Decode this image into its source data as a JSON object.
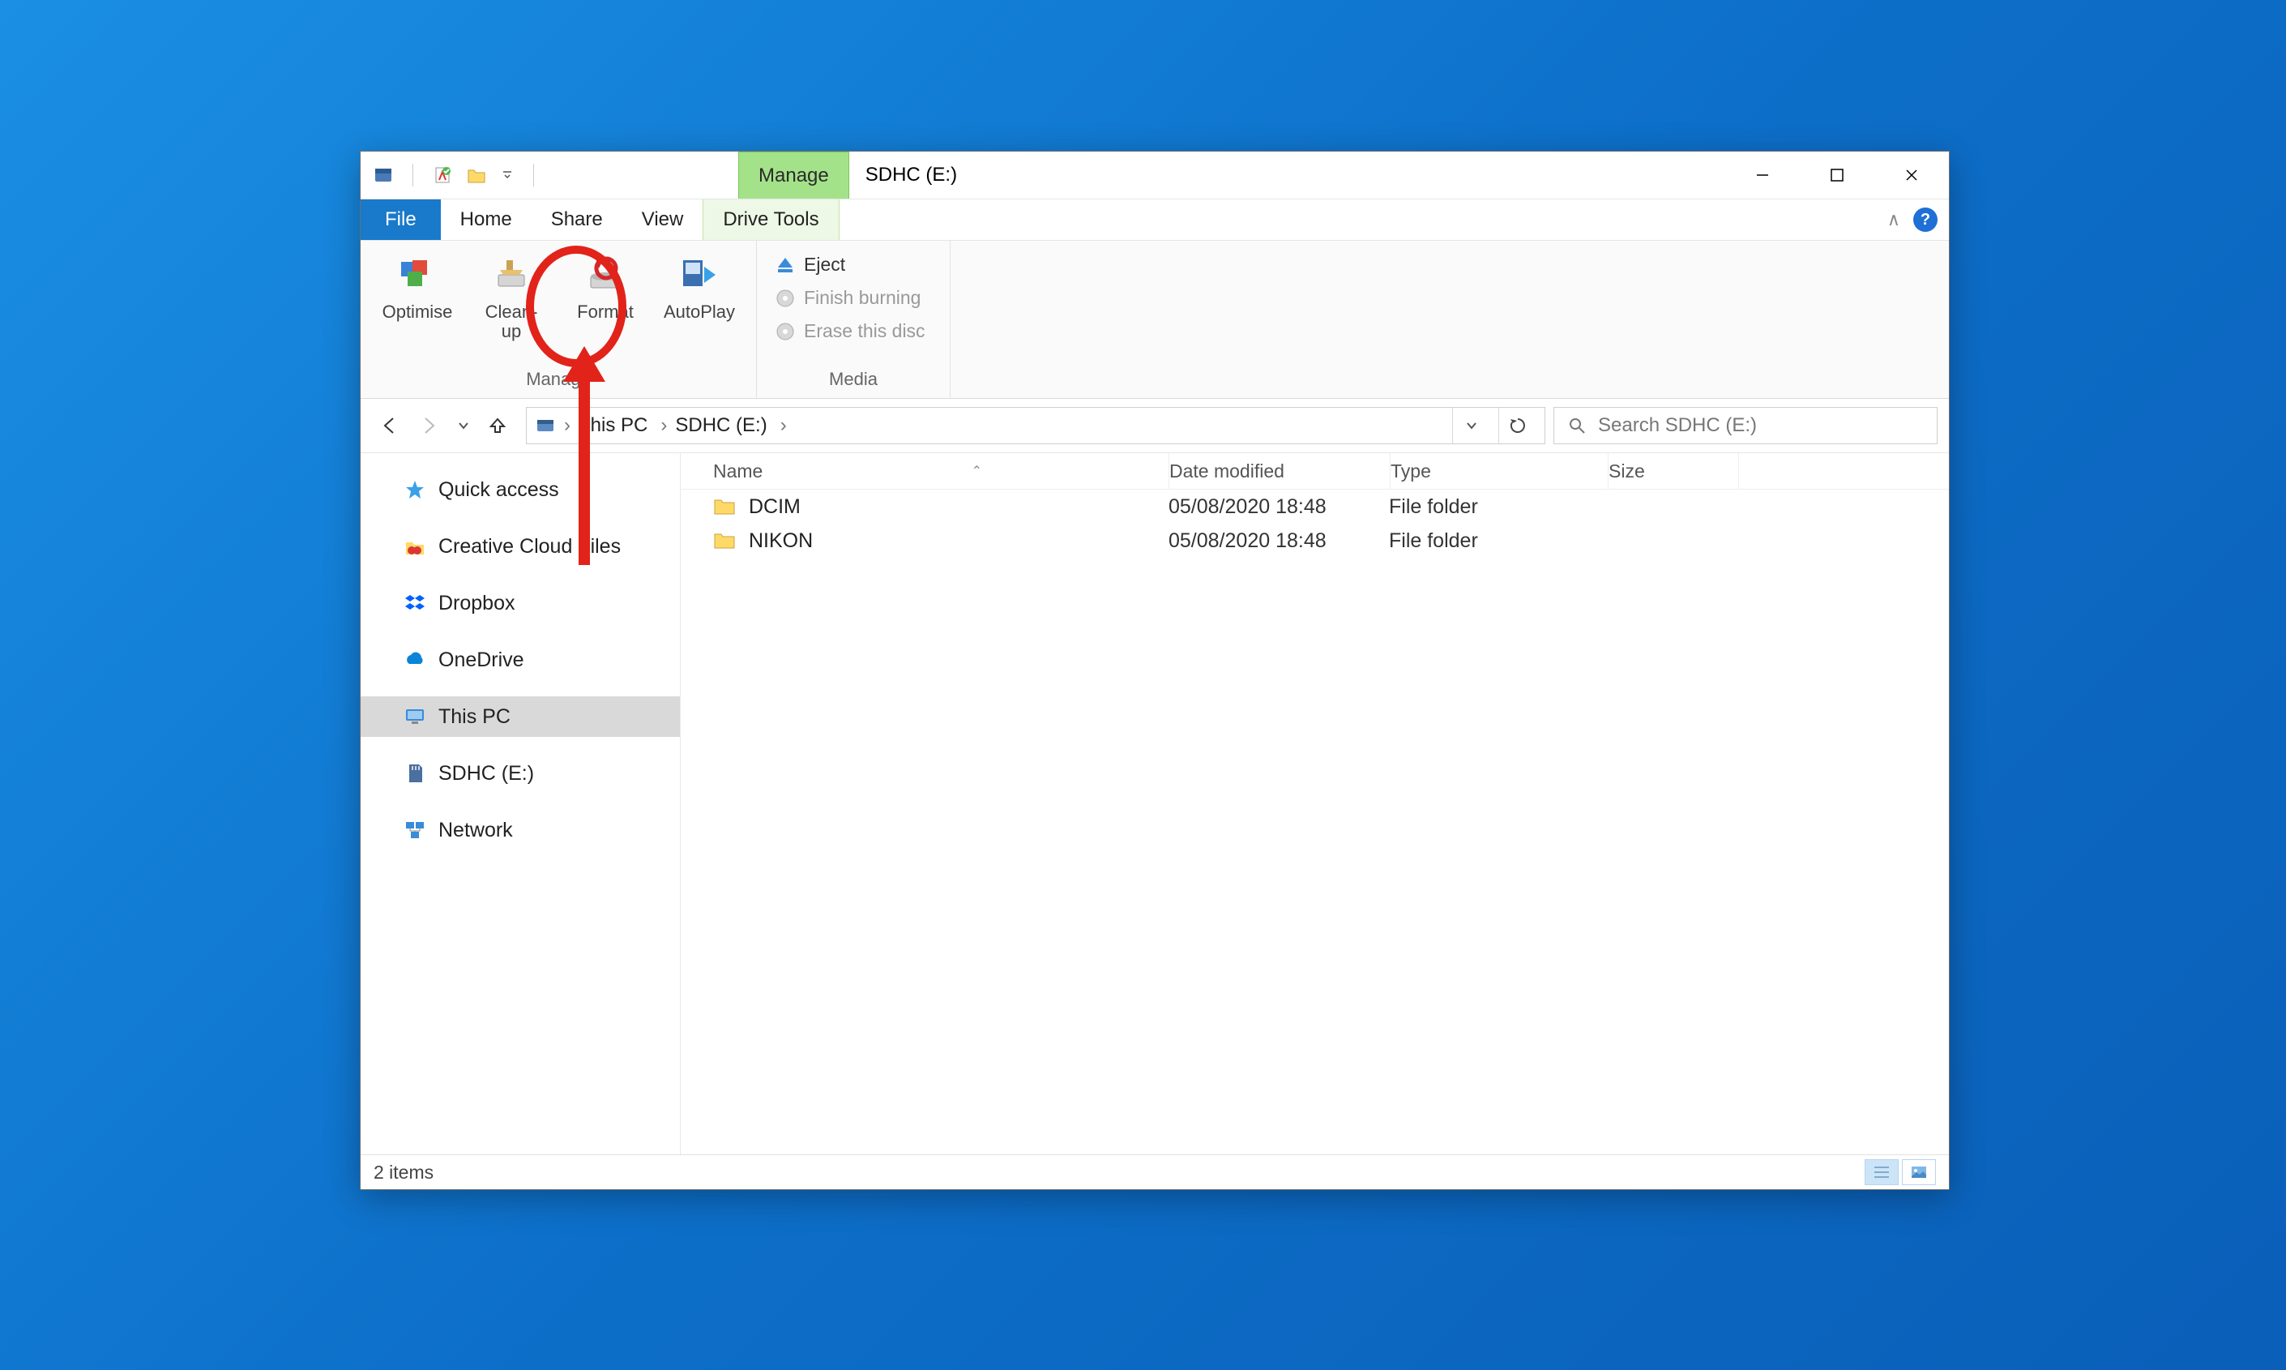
{
  "titlebar": {
    "context_tab": "Manage",
    "window_title": "SDHC (E:)"
  },
  "tabs": {
    "file": "File",
    "home": "Home",
    "share": "Share",
    "view": "View",
    "drive_tools": "Drive Tools"
  },
  "ribbon": {
    "manage_group": {
      "label": "Manage",
      "optimise": "Optimise",
      "cleanup": "Clean-\nup",
      "format": "Format",
      "autoplay": "AutoPlay"
    },
    "media_group": {
      "label": "Media",
      "eject": "Eject",
      "finish": "Finish burning",
      "erase": "Erase this disc"
    }
  },
  "address": {
    "crumb1": "This PC",
    "crumb2": "SDHC (E:)"
  },
  "search": {
    "placeholder": "Search SDHC (E:)"
  },
  "nav": {
    "quick_access": "Quick access",
    "creative_cloud": "Creative Cloud Files",
    "dropbox": "Dropbox",
    "onedrive": "OneDrive",
    "this_pc": "This PC",
    "sdhc": "SDHC (E:)",
    "network": "Network"
  },
  "columns": {
    "name": "Name",
    "date": "Date modified",
    "type": "Type",
    "size": "Size"
  },
  "rows": [
    {
      "name": "DCIM",
      "date": "05/08/2020 18:48",
      "type": "File folder",
      "size": ""
    },
    {
      "name": "NIKON",
      "date": "05/08/2020 18:48",
      "type": "File folder",
      "size": ""
    }
  ],
  "status": {
    "items": "2 items"
  }
}
